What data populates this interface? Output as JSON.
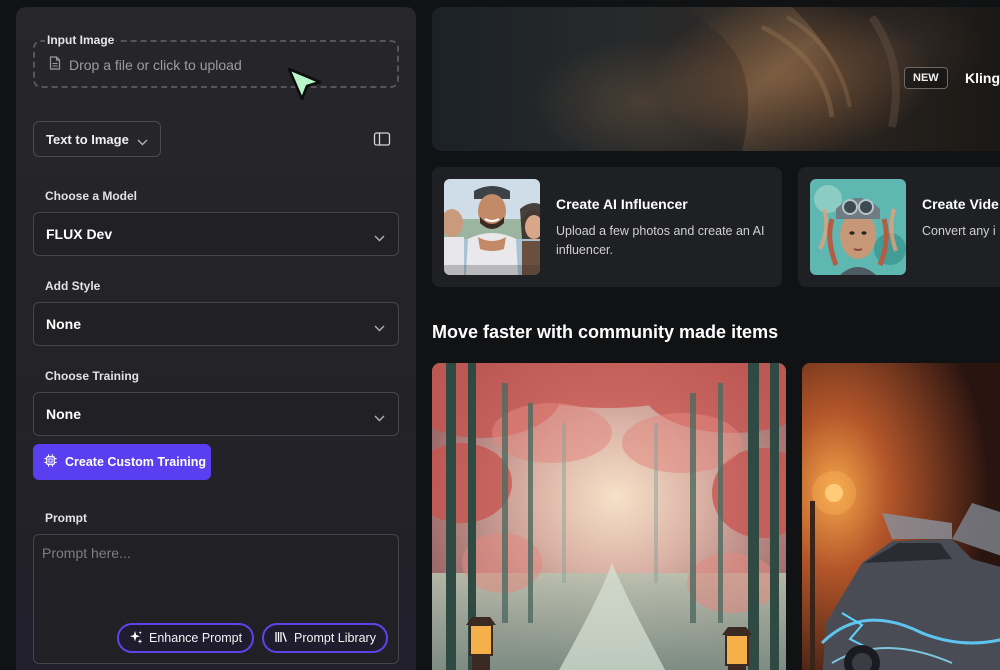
{
  "upload": {
    "label": "Input Image",
    "hint": "Drop a file or click to upload"
  },
  "mode": {
    "selected": "Text to Image"
  },
  "model": {
    "label": "Choose a Model",
    "value": "FLUX Dev"
  },
  "style": {
    "label": "Add Style",
    "value": "None"
  },
  "training": {
    "label": "Choose Training",
    "value": "None",
    "create_button": "Create Custom Training"
  },
  "prompt": {
    "label": "Prompt",
    "placeholder": "Prompt here...",
    "enhance_button": "Enhance Prompt",
    "library_button": "Prompt Library"
  },
  "hero": {
    "badge": "NEW",
    "title": "Kling"
  },
  "features": [
    {
      "title": "Create AI Influencer",
      "description": "Upload a few photos and create an AI influencer."
    },
    {
      "title": "Create Vide",
      "description": "Convert any i"
    }
  ],
  "community": {
    "title": "Move faster with community made items"
  },
  "colors": {
    "accent": "#5a3ff0",
    "panel_bg": "#27272b",
    "page_bg": "#111214",
    "card_bg": "#1f2023"
  },
  "icons": {
    "upload": "file-icon",
    "cursor": "pointer-cursor-icon",
    "sidebar_toggle": "sidebar-toggle-icon",
    "chip": "chip-icon",
    "sparkle": "sparkle-icon",
    "library": "library-icon"
  }
}
